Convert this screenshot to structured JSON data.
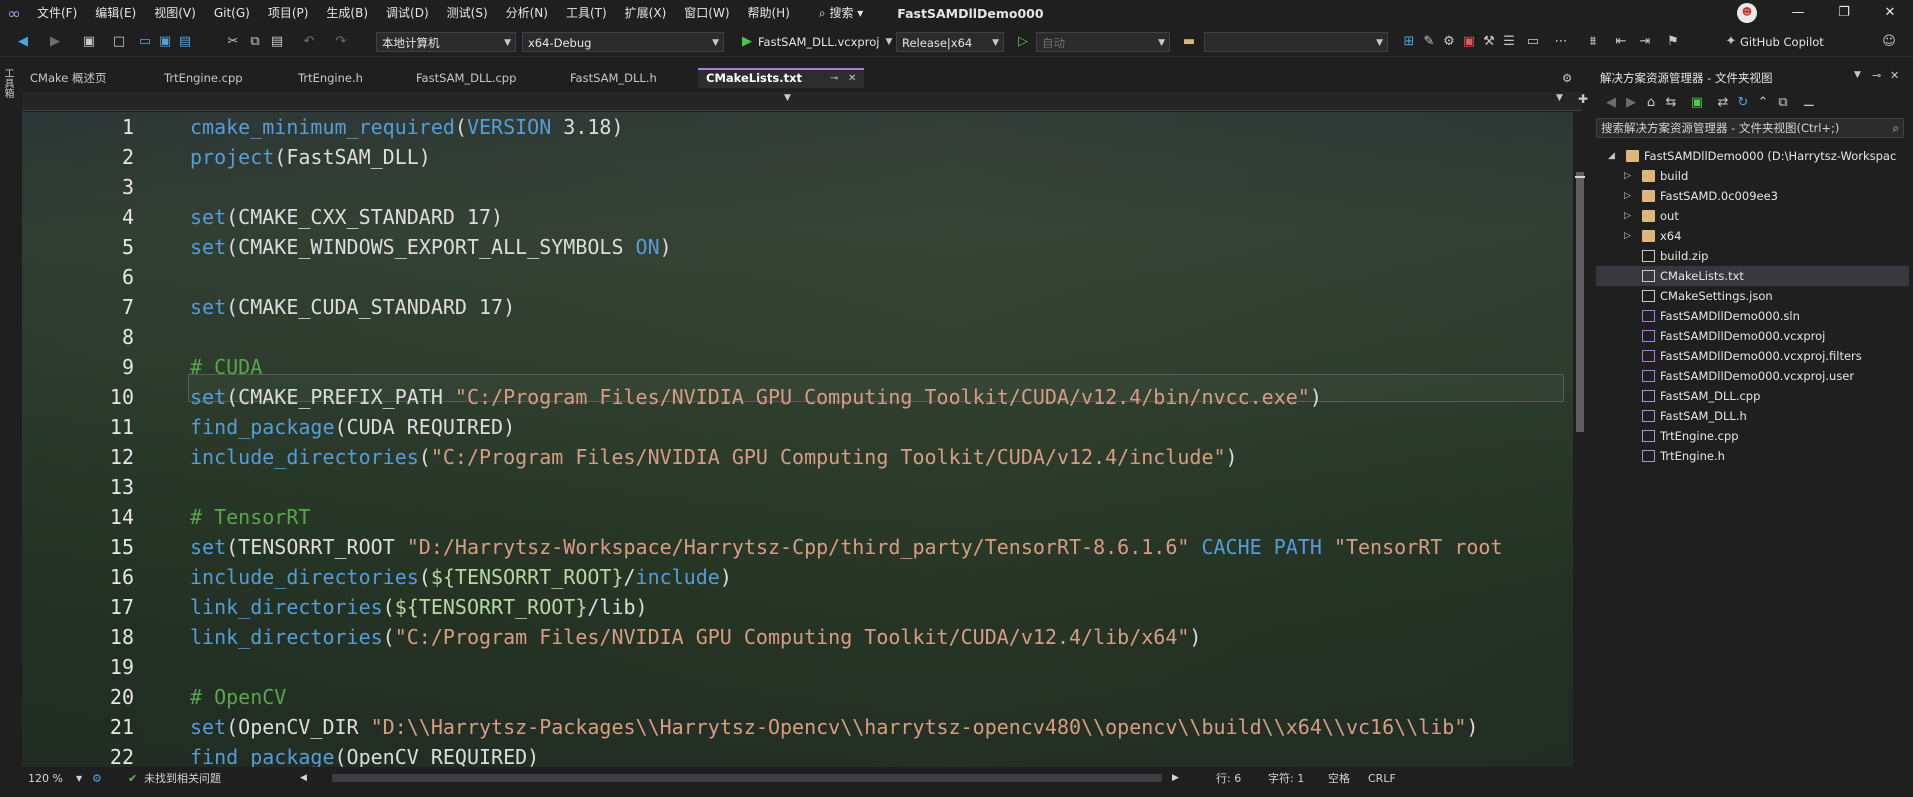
{
  "menubar": {
    "items": [
      "文件(F)",
      "编辑(E)",
      "视图(V)",
      "Git(G)",
      "项目(P)",
      "生成(B)",
      "调试(D)",
      "测试(S)",
      "分析(N)",
      "工具(T)",
      "扩展(X)",
      "窗口(W)",
      "帮助(H)"
    ],
    "search_label": "搜索",
    "window_title": "FastSAMDllDemo000"
  },
  "toolbar": {
    "machine": "本地计算机",
    "config": "x64-Debug",
    "startup_project": "FastSAM_DLL.vcxproj",
    "build_config": "Release|x64",
    "auto": "自动",
    "empty_combo": "",
    "copilot": "GitHub Copilot"
  },
  "left_strip": {
    "label": "工具箱"
  },
  "tabs": [
    {
      "label": "CMake 概述页"
    },
    {
      "label": "TrtEngine.cpp"
    },
    {
      "label": "TrtEngine.h"
    },
    {
      "label": "FastSAM_DLL.cpp"
    },
    {
      "label": "FastSAM_DLL.h"
    },
    {
      "label": "CMakeLists.txt",
      "active": true
    }
  ],
  "editor": {
    "line_numbers": [
      "1",
      "2",
      "3",
      "4",
      "5",
      "6",
      "7",
      "8",
      "9",
      "10",
      "11",
      "12",
      "13",
      "14",
      "15",
      "16",
      "17",
      "18",
      "19",
      "20",
      "21",
      "22"
    ],
    "lines": [
      [
        [
          "kw",
          "cmake_minimum_required"
        ],
        [
          "nm",
          "("
        ],
        [
          "kw",
          "VERSION"
        ],
        [
          "nm",
          " 3.18)"
        ]
      ],
      [
        [
          "kw",
          "project"
        ],
        [
          "nm",
          "(FastSAM_DLL)"
        ]
      ],
      [],
      [
        [
          "kw",
          "set"
        ],
        [
          "nm",
          "(CMAKE_CXX_STANDARD 17)"
        ]
      ],
      [
        [
          "kw",
          "set"
        ],
        [
          "nm",
          "(CMAKE_WINDOWS_EXPORT_ALL_SYMBOLS "
        ],
        [
          "kw",
          "ON"
        ],
        [
          "nm",
          ")"
        ]
      ],
      [],
      [
        [
          "kw",
          "set"
        ],
        [
          "nm",
          "(CMAKE_CUDA_STANDARD 17)"
        ]
      ],
      [],
      [
        [
          "cm",
          "# CUDA"
        ]
      ],
      [
        [
          "kw",
          "set"
        ],
        [
          "nm",
          "(CMAKE_PREFIX_PATH "
        ],
        [
          "st",
          "\"C:/Program Files/NVIDIA GPU Computing Toolkit/CUDA/v12.4/bin/nvcc.exe\""
        ],
        [
          "nm",
          ")"
        ]
      ],
      [
        [
          "kw",
          "find_package"
        ],
        [
          "nm",
          "(CUDA REQUIRED)"
        ]
      ],
      [
        [
          "kw",
          "include_directories"
        ],
        [
          "nm",
          "("
        ],
        [
          "st",
          "\"C:/Program Files/NVIDIA GPU Computing Toolkit/CUDA/v12.4/include\""
        ],
        [
          "nm",
          ")"
        ]
      ],
      [],
      [
        [
          "cm",
          "# TensorRT"
        ]
      ],
      [
        [
          "kw",
          "set"
        ],
        [
          "nm",
          "(TENSORRT_ROOT "
        ],
        [
          "st",
          "\"D:/Harrytsz-Workspace/Harrytsz-Cpp/third_party/TensorRT-8.6.1.6\""
        ],
        [
          "nm",
          " "
        ],
        [
          "kw",
          "CACHE PATH"
        ],
        [
          "nm",
          " "
        ],
        [
          "st",
          "\"TensorRT root"
        ]
      ],
      [
        [
          "kw",
          "include_directories"
        ],
        [
          "nm",
          "("
        ],
        [
          "vr",
          "${TENSORRT_ROOT}"
        ],
        [
          "nm",
          "/"
        ],
        [
          "kw",
          "include"
        ],
        [
          "nm",
          ")"
        ]
      ],
      [
        [
          "kw",
          "link_directories"
        ],
        [
          "nm",
          "("
        ],
        [
          "vr",
          "${TENSORRT_ROOT}"
        ],
        [
          "nm",
          "/lib)"
        ]
      ],
      [
        [
          "kw",
          "link_directories"
        ],
        [
          "nm",
          "("
        ],
        [
          "st",
          "\"C:/Program Files/NVIDIA GPU Computing Toolkit/CUDA/v12.4/lib/x64\""
        ],
        [
          "nm",
          ")"
        ]
      ],
      [],
      [
        [
          "cm",
          "# OpenCV"
        ]
      ],
      [
        [
          "kw",
          "set"
        ],
        [
          "nm",
          "(OpenCV_DIR "
        ],
        [
          "st",
          "\"D:\\\\Harrytsz-Packages\\\\Harrytsz-Opencv\\\\harrytsz-opencv480\\\\opencv\\\\build\\\\x64\\\\vc16\\\\lib\""
        ],
        [
          "nm",
          ")"
        ]
      ],
      [
        [
          "kw",
          "find_package"
        ],
        [
          "nm",
          "(OpenCV REQUIRED)"
        ]
      ]
    ]
  },
  "status": {
    "zoom": "120 %",
    "issues": "未找到相关问题",
    "line": "行: 6",
    "char": "字符: 1",
    "whitespace": "空格",
    "eol": "CRLF"
  },
  "solution_explorer": {
    "title": "解决方案资源管理器 - 文件夹视图",
    "search_placeholder": "搜索解决方案资源管理器 - 文件夹视图(Ctrl+;)",
    "root": "FastSAMDllDemo000 (D:\\Harrytsz-Workspac",
    "items": [
      {
        "label": "build",
        "type": "folder"
      },
      {
        "label": "FastSAMD.0c009ee3",
        "type": "folder"
      },
      {
        "label": "out",
        "type": "folder"
      },
      {
        "label": "x64",
        "type": "folder"
      },
      {
        "label": "build.zip",
        "type": "file"
      },
      {
        "label": "CMakeLists.txt",
        "type": "file",
        "selected": true
      },
      {
        "label": "CMakeSettings.json",
        "type": "file"
      },
      {
        "label": "FastSAMDllDemo000.sln",
        "type": "file"
      },
      {
        "label": "FastSAMDllDemo000.vcxproj",
        "type": "file"
      },
      {
        "label": "FastSAMDllDemo000.vcxproj.filters",
        "type": "file"
      },
      {
        "label": "FastSAMDllDemo000.vcxproj.user",
        "type": "file"
      },
      {
        "label": "FastSAM_DLL.cpp",
        "type": "file"
      },
      {
        "label": "FastSAM_DLL.h",
        "type": "file"
      },
      {
        "label": "TrtEngine.cpp",
        "type": "file"
      },
      {
        "label": "TrtEngine.h",
        "type": "file"
      }
    ]
  }
}
